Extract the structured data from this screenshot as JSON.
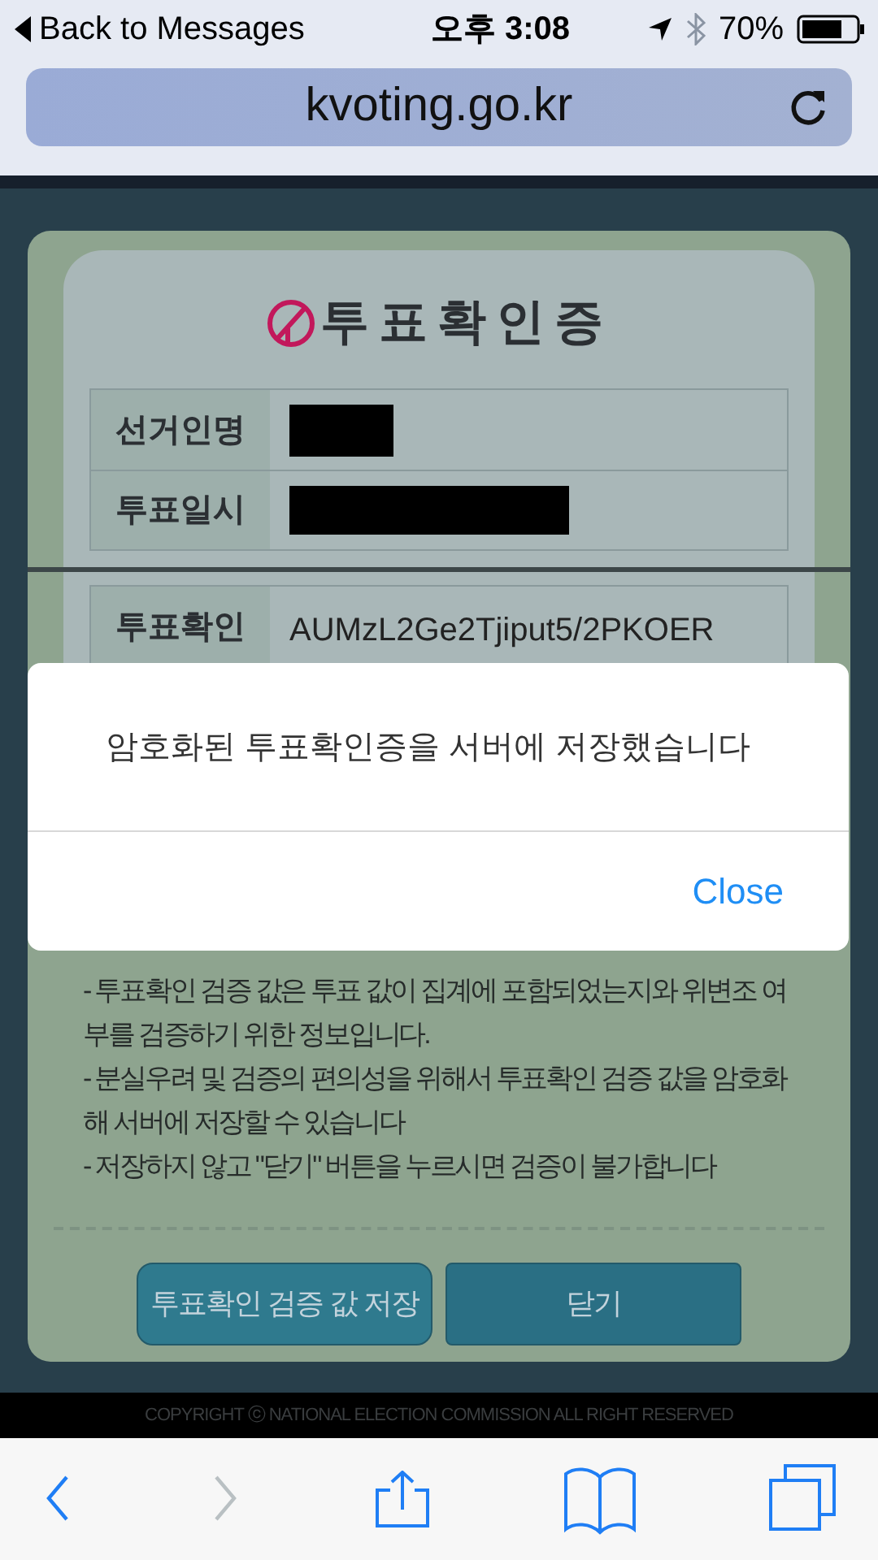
{
  "status_bar": {
    "back_label": "Back to Messages",
    "time": "오후 3:08",
    "battery": "70%"
  },
  "address_bar": {
    "url": "kvoting.go.kr"
  },
  "certificate": {
    "title": "투표확인증",
    "fields": [
      {
        "label": "선거인명",
        "redacted": true
      },
      {
        "label": "투표일시",
        "redacted": true
      }
    ],
    "verification": {
      "label": "투표확인",
      "value": "AUMzL2Ge2Tjiput5/2PKOER"
    },
    "notes": [
      "- 투표확인 검증 값은 투표 값이 집계에 포함되었는지와 위변조 여부를 검증하기 위한 정보입니다.",
      "- 분실우려 및 검증의 편의성을 위해서 투표확인 검증 값을 암호화해 서버에 저장할 수 있습니다",
      "- 저장하지 않고 \"닫기\" 버튼을 누르시면 검증이 불가합니다"
    ],
    "buttons": [
      {
        "label": "투표확인 검증 값 저장",
        "kind": "save"
      },
      {
        "label": "닫기",
        "kind": "close"
      }
    ]
  },
  "alert": {
    "message": "암호화된 투표확인증을 서버에 저장했습니다",
    "button": "Close"
  },
  "footer": "COPYRIGHT ⓒ NATIONAL ELECTION COMMISSION ALL RIGHT RESERVED",
  "toolbar": [
    {
      "kind": "back",
      "disabled": false
    },
    {
      "kind": "forward",
      "disabled": true
    },
    {
      "kind": "share",
      "disabled": false
    },
    {
      "kind": "bookmarks",
      "disabled": false
    },
    {
      "kind": "tabs",
      "disabled": false
    }
  ]
}
